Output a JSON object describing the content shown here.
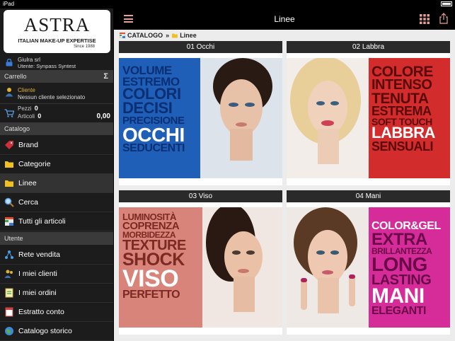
{
  "status_bar": {
    "device": "iPad",
    "time": "",
    "battery_level": 1
  },
  "brand": {
    "logo_text": "ASTRA",
    "tagline": "ITALIAN MAKE-UP EXPERTISE",
    "since": "Since 1988"
  },
  "user": {
    "name": "Giulra srl",
    "line": "Utente: Synpass Syntest",
    "icon": "lock-icon"
  },
  "cart": {
    "header": "Carrello",
    "sigma": "Σ",
    "client_label": "Cliente",
    "client_value": "Nessun cliente selezionato",
    "pezzi_label": "Pezzi",
    "pezzi_value": "0",
    "articoli_label": "Articoli",
    "articoli_value": "0",
    "total": "0,00"
  },
  "catalog_section": {
    "header": "Catalogo",
    "items": [
      {
        "label": "Brand",
        "icon": "tag-icon"
      },
      {
        "label": "Categorie",
        "icon": "folder-icon"
      },
      {
        "label": "Linee",
        "icon": "folder-icon",
        "active": true
      },
      {
        "label": "Cerca",
        "icon": "search-icon"
      },
      {
        "label": "Tutti gli articoli",
        "icon": "grid-list-icon"
      }
    ]
  },
  "user_section": {
    "header": "Utente",
    "items": [
      {
        "label": "Rete vendita",
        "icon": "network-icon"
      },
      {
        "label": "I miei clienti",
        "icon": "clients-icon"
      },
      {
        "label": "I miei ordini",
        "icon": "orders-icon"
      },
      {
        "label": "Estratto conto",
        "icon": "statement-icon"
      },
      {
        "label": "Catalogo storico",
        "icon": "globe-icon"
      }
    ]
  },
  "navbar": {
    "title": "Linee"
  },
  "breadcrumb": {
    "root": "CATALOGO",
    "separator": "»",
    "current": "Linee"
  },
  "tiles": [
    {
      "title": "01 Occhi",
      "panel_color": "#1f5fb8",
      "lines": [
        "VOLUME",
        "ESTREMO",
        "COLORI",
        "DECISI",
        "PRECISIONE",
        "OCCHI",
        "SEDUCENTI"
      ]
    },
    {
      "title": "02 Labbra",
      "panel_color": "#d22c2c",
      "lines": [
        "COLORE",
        "INTENSO",
        "TENUTA",
        "ESTREMA",
        "SOFT TOUCH",
        "LABBRA",
        "SENSUALI"
      ]
    },
    {
      "title": "03 Viso",
      "panel_color": "#d9847a",
      "lines": [
        "LUMINOSITÀ",
        "COPRENZA",
        "MORBIDEZZA",
        "TEXTURE",
        "SHOCK",
        "VISO",
        "PERFETTO"
      ]
    },
    {
      "title": "04 Mani",
      "panel_color": "#d62c9a",
      "lines": [
        "COLOR&GEL",
        "EXTRA",
        "BRILLANTEZZA",
        "LONG",
        "LASTING",
        "MANI",
        "ELEGANTI"
      ]
    }
  ]
}
